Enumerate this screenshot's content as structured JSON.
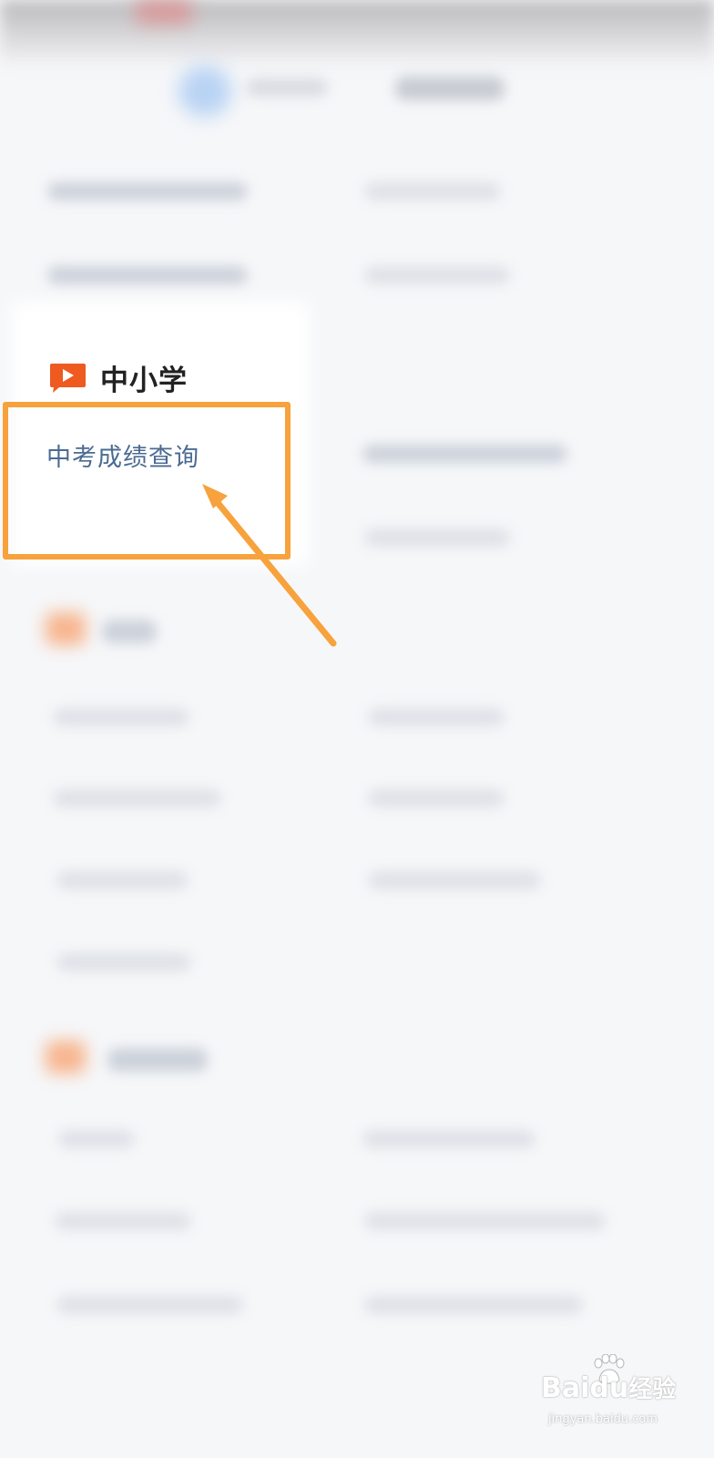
{
  "section": {
    "title": "中小学",
    "icon": "video-play-icon",
    "icon_color": "#ee5a1f"
  },
  "highlighted_item": {
    "label": "中考成绩查询",
    "text_color": "#4b6b92"
  },
  "annotation": {
    "highlight_color": "#f7a23c"
  },
  "watermark": {
    "brand_left": "Bai",
    "brand_right": "du",
    "brand_cn": "经验",
    "site": "jingyan.baidu.com"
  }
}
